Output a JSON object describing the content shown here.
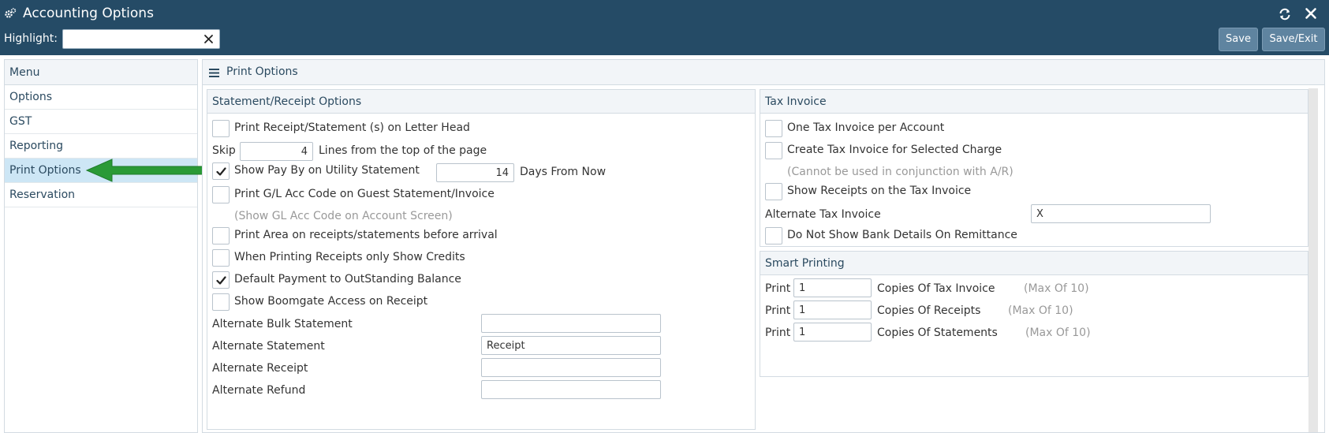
{
  "window": {
    "title": "Accounting Options"
  },
  "highlight": {
    "label": "Highlight:",
    "value": "",
    "placeholder": ""
  },
  "toolbar": {
    "save_label": "Save",
    "save_exit_label": "Save/Exit"
  },
  "menu": {
    "header": "Menu",
    "items": [
      {
        "label": "Options"
      },
      {
        "label": "GST"
      },
      {
        "label": "Reporting"
      },
      {
        "label": "Print Options"
      },
      {
        "label": "Reservation"
      }
    ],
    "active_index": 3
  },
  "main": {
    "title": "Print Options"
  },
  "statement": {
    "header": "Statement/Receipt Options",
    "letterhead": {
      "label": "Print Receipt/Statement (s) on Letter Head",
      "checked": false
    },
    "skip_label": "Skip",
    "skip_value": "4",
    "skip_suffix": "Lines from the top of the page",
    "payby": {
      "label": "Show Pay By on Utility Statement",
      "checked": true
    },
    "payby_days": "14",
    "payby_suffix": "Days From Now",
    "glcode": {
      "label": "Print G/L Acc Code on Guest Statement/Invoice",
      "checked": false
    },
    "glcode_note": "(Show GL Acc Code on Account Screen)",
    "area": {
      "label": "Print Area on receipts/statements before arrival",
      "checked": false
    },
    "credits": {
      "label": "When Printing Receipts only Show Credits",
      "checked": false
    },
    "default_payment": {
      "label": "Default Payment to OutStanding Balance",
      "checked": true
    },
    "boomgate": {
      "label": "Show Boomgate Access on Receipt",
      "checked": false
    },
    "alt_bulk": {
      "label": "Alternate Bulk Statement",
      "value": ""
    },
    "alt_statement": {
      "label": "Alternate Statement",
      "value": "Receipt"
    },
    "alt_receipt": {
      "label": "Alternate Receipt",
      "value": ""
    },
    "alt_refund": {
      "label": "Alternate Refund",
      "value": ""
    }
  },
  "tax": {
    "header": "Tax Invoice",
    "one_per_account": {
      "label": "One Tax Invoice per Account",
      "checked": false
    },
    "selected_charge": {
      "label": "Create Tax Invoice for Selected Charge",
      "checked": false
    },
    "selected_charge_note": "(Cannot be used in conjunction with A/R)",
    "show_receipts": {
      "label": "Show Receipts on the Tax Invoice",
      "checked": false
    },
    "alternate": {
      "label": "Alternate Tax Invoice",
      "value": "X"
    },
    "no_bank": {
      "label": "Do Not Show Bank Details On Remittance",
      "checked": false
    }
  },
  "smart": {
    "header": "Smart Printing",
    "rows": [
      {
        "prefix": "Print",
        "value": "1",
        "label": "Copies Of Tax Invoice",
        "note": "(Max Of 10)"
      },
      {
        "prefix": "Print",
        "value": "1",
        "label": "Copies Of Receipts",
        "note": "(Max Of 10)"
      },
      {
        "prefix": "Print",
        "value": "1",
        "label": "Copies Of Statements",
        "note": "(Max Of 10)"
      }
    ]
  },
  "colors": {
    "topbar": "#254b66",
    "button": "#5f84a0",
    "menu_active": "#cde6f5",
    "arrow": "#2a9a36"
  },
  "icons": [
    "gear-icon",
    "refresh-icon",
    "close-icon",
    "clear-icon",
    "hamburger-icon",
    "check-icon",
    "arrow-icon"
  ]
}
